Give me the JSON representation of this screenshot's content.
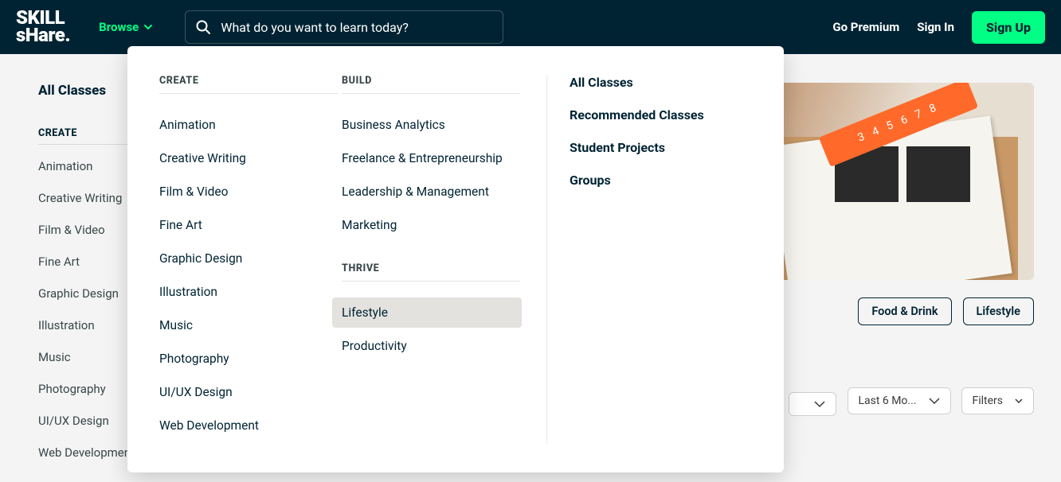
{
  "header": {
    "logo_line1": "SKILL",
    "logo_line2": "sHare.",
    "browse": "Browse",
    "search_placeholder": "What do you want to learn today?",
    "go_premium": "Go Premium",
    "sign_in": "Sign In",
    "sign_up": "Sign Up"
  },
  "sidebar": {
    "all_classes": "All Classes",
    "create_head": "CREATE",
    "items": [
      "Animation",
      "Creative Writing",
      "Film & Video",
      "Fine Art",
      "Graphic Design",
      "Illustration",
      "Music",
      "Photography",
      "UI/UX Design",
      "Web Development"
    ]
  },
  "mega": {
    "create_head": "CREATE",
    "create": [
      "Animation",
      "Creative Writing",
      "Film & Video",
      "Fine Art",
      "Graphic Design",
      "Illustration",
      "Music",
      "Photography",
      "UI/UX Design",
      "Web Development"
    ],
    "build_head": "BUILD",
    "build": [
      "Business Analytics",
      "Freelance & Entrepreneurship",
      "Leadership & Management",
      "Marketing"
    ],
    "thrive_head": "THRIVE",
    "thrive": [
      "Lifestyle",
      "Productivity"
    ],
    "hovered": "Lifestyle",
    "right": [
      "All Classes",
      "Recommended Classes",
      "Student Projects",
      "Groups"
    ]
  },
  "content": {
    "ruler_text": "3 4 5 6 7 8",
    "tags": [
      "Food & Drink",
      "Lifestyle"
    ],
    "filters": {
      "period": "Last 6 Mo...",
      "filters": "Filters"
    }
  }
}
